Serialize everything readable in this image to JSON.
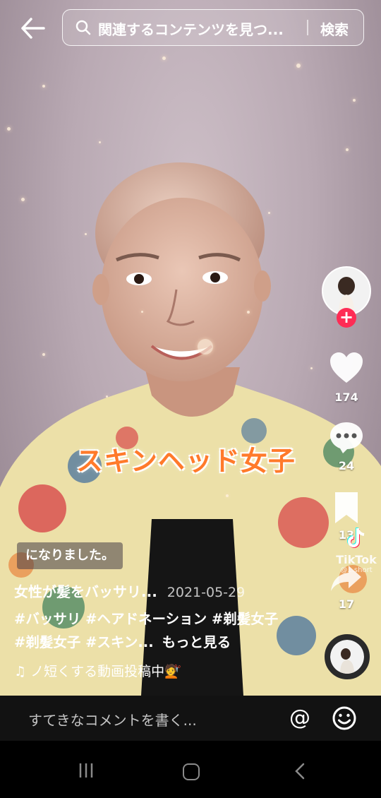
{
  "search": {
    "query": "関連するコンテンツを見つ...",
    "button_label": "検索"
  },
  "video": {
    "overlay_caption": "スキンヘッド女子",
    "chip_text": "になりました。"
  },
  "rail": {
    "likes": "174",
    "comments": "24",
    "saves": "13",
    "shares": "17",
    "watermark_brand": "TikTok",
    "watermark_handle": "@...short"
  },
  "caption": {
    "title": "女性が髪をバッサリ...",
    "date": "2021-05-29",
    "hashtags": "#バッサリ #ヘアドネーション #剃髪女子 #剃髪女子 #スキン...",
    "more_label": "もっと見る",
    "music": "ノ短くする動画投稿中💇"
  },
  "comment_bar": {
    "placeholder": "すてきなコメントを書く...",
    "at_symbol": "@"
  },
  "colors": {
    "accent": "#fe2c55",
    "overlay_text": "#ff7a2b"
  }
}
